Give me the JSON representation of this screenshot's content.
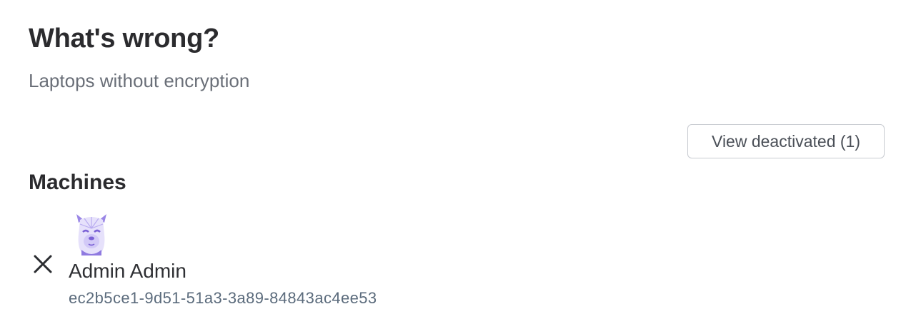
{
  "header": {
    "title": "What's wrong?",
    "subtitle": "Laptops without encryption"
  },
  "actions": {
    "view_deactivated_label": "View deactivated (1)"
  },
  "machines": {
    "section_title": "Machines",
    "items": [
      {
        "owner": "Admin Admin",
        "id": "ec2b5ce1-9d51-51a3-3a89-84843ac4ee53",
        "avatar_icon": "llama-avatar",
        "action_icon": "close-icon"
      }
    ]
  },
  "colors": {
    "avatar_accent": "#7b61d6",
    "id_text": "#5b6b7c"
  }
}
